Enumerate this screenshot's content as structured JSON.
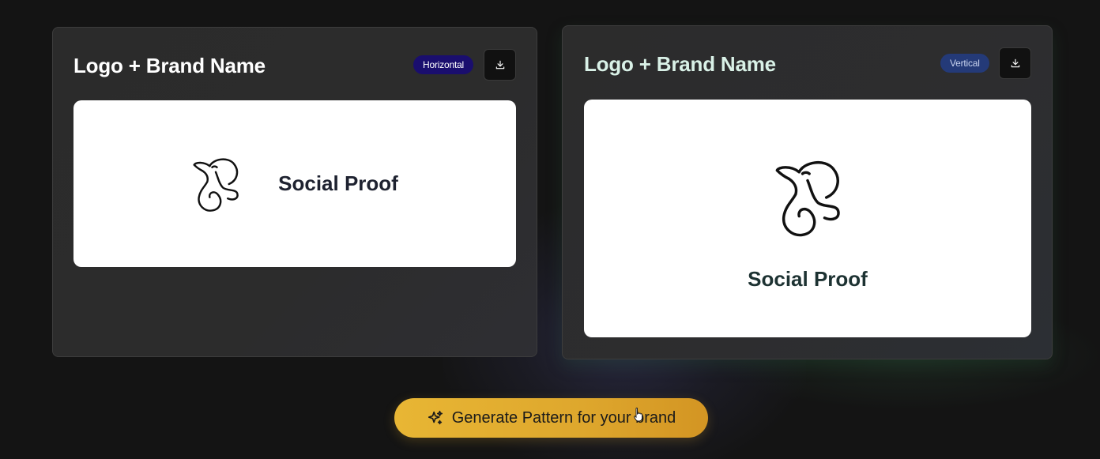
{
  "cards": [
    {
      "title": "Logo + Brand Name",
      "badge": "Horizontal",
      "download_icon": "download-icon",
      "brand_text": "Social Proof",
      "logo_icon": "elephant-logo-icon"
    },
    {
      "title": "Logo + Brand Name",
      "badge": "Vertical",
      "download_icon": "download-icon",
      "brand_text": "Social Proof",
      "logo_icon": "elephant-logo-icon"
    }
  ],
  "cta": {
    "label": "Generate Pattern for your brand",
    "icon": "sparkle-icon"
  },
  "colors": {
    "background": "#141414",
    "card": "#2b2b2b",
    "horizontal_badge": "#1a0e6e",
    "vertical_badge": "#243a78",
    "cta_gold": "#e0aa2e"
  }
}
